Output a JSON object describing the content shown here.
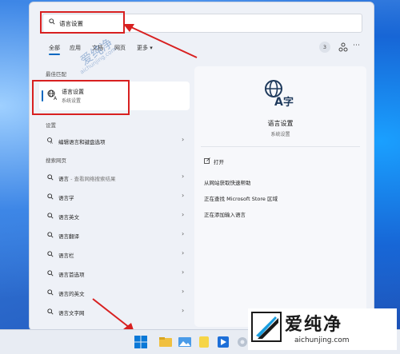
{
  "search": {
    "value": "语言设置"
  },
  "tabs": [
    {
      "label": "全部"
    },
    {
      "label": "应用"
    },
    {
      "label": "文档"
    },
    {
      "label": "网页"
    },
    {
      "label": "更多 ▾"
    }
  ],
  "header_right": {
    "badge": "3"
  },
  "left": {
    "best_match_title": "最佳匹配",
    "best_match": {
      "title": "语言设置",
      "subtitle": "系统设置"
    },
    "settings_title": "设置",
    "settings_items": [
      {
        "label": "编辑语言和键盘选项"
      }
    ],
    "web_title": "搜索网页",
    "web_items": [
      {
        "label": "语言",
        "hint": " - 查看网络搜索结果"
      },
      {
        "label": "语言学",
        "hint": ""
      },
      {
        "label": "语言英文",
        "hint": ""
      },
      {
        "label": "语言翻译",
        "hint": ""
      },
      {
        "label": "语言栏",
        "hint": ""
      },
      {
        "label": "语言首选项",
        "hint": ""
      },
      {
        "label": "语言的英文",
        "hint": ""
      },
      {
        "label": "语言文字网",
        "hint": ""
      }
    ]
  },
  "right": {
    "title": "语言设置",
    "subtitle": "系统设置",
    "actions": [
      {
        "label": "打开"
      },
      {
        "label": "从网站获取快速帮助"
      },
      {
        "label": "正在查找 Microsoft Store 区域"
      },
      {
        "label": "正在添加输入语言"
      }
    ]
  },
  "watermark": {
    "text": "爱纯净",
    "url": "aichunjing.com"
  },
  "colors": {
    "accent": "#0067c0",
    "highlight": "#d82020"
  },
  "icons": [
    "search-icon",
    "language-settings-icon",
    "keyboard-settings-icon",
    "chevron-right-icon",
    "open-icon",
    "windows-start-icon"
  ]
}
